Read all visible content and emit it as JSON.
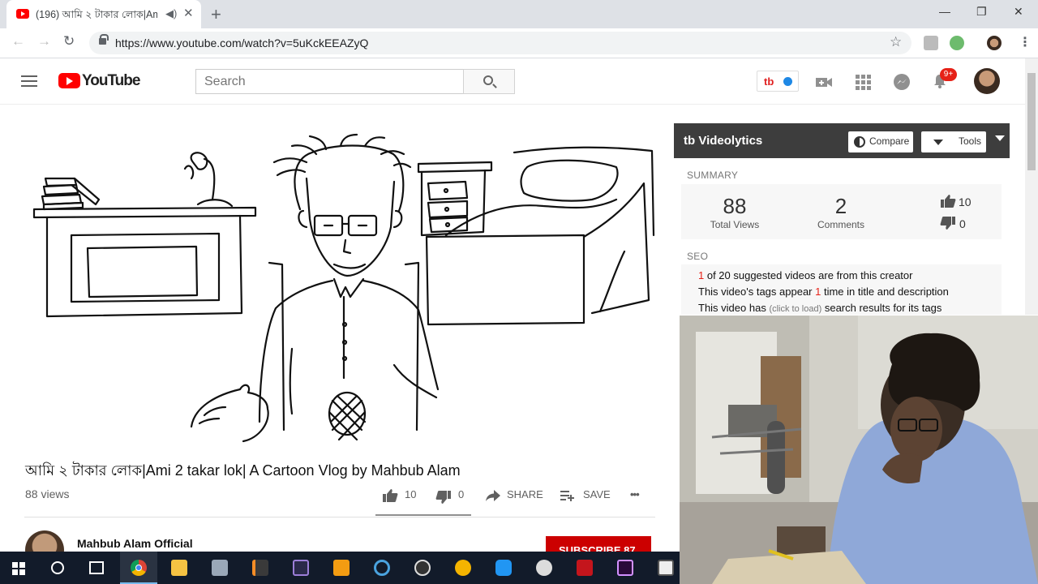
{
  "browser": {
    "tab_title": "(196) আমি ২ টাকার লোক|Am",
    "url": "https://www.youtube.com/watch?v=5uKckEEAZyQ",
    "new_tab_glyph": "+",
    "tab_close_glyph": "✕",
    "window": {
      "minimize": "—",
      "maximize": "❐",
      "close": "✕"
    }
  },
  "youtube": {
    "logo_text": "YouTube",
    "search_placeholder": "Search",
    "notification_count": "9+"
  },
  "extension": {
    "logo": "tb"
  },
  "video": {
    "title": "আমি ২ টাকার লোক|Ami 2 takar lok| A Cartoon Vlog by Mahbub Alam",
    "views": "88 views",
    "likes": "10",
    "dislikes": "0",
    "share_label": "SHARE",
    "save_label": "SAVE",
    "more_label": "•••"
  },
  "channel": {
    "name": "Mahbub Alam Official",
    "subscribe_label": "SUBSCRIBE 87"
  },
  "videolytics": {
    "title": "Videolytics",
    "brand": "tb",
    "compare_label": "Compare",
    "tools_label": "Tools",
    "summary_heading": "SUMMARY",
    "total_views": "88",
    "total_views_label": "Total Views",
    "comments": "2",
    "comments_label": "Comments",
    "likes": "10",
    "dislikes": "0",
    "seo_heading": "SEO",
    "seo_line1_num": "1",
    "seo_line1_text": " of 20 suggested videos are from this creator",
    "seo_line2_pre": "This video's tags appear ",
    "seo_line2_num": "1",
    "seo_line2_post": " time in title and description",
    "seo_line3_pre": "This video has ",
    "seo_line3_link": "(click to load)",
    "seo_line3_post": " search results for its tags"
  },
  "colors": {
    "yt_red": "#ff0000",
    "subscribe_red": "#cc0000",
    "badge_red": "#e62117",
    "vl_header": "#3d3d3d",
    "taskbar": "#121b2a"
  }
}
